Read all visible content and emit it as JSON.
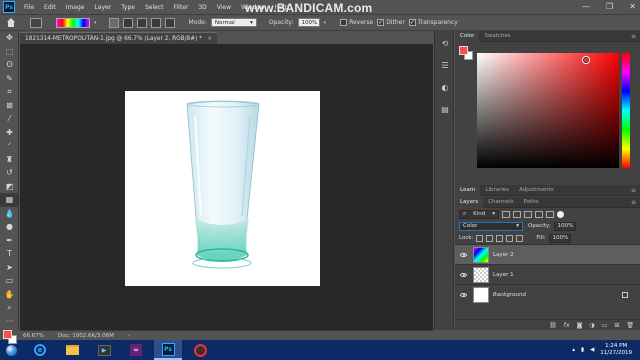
{
  "app": {
    "logo": "Ps",
    "menu": [
      "File",
      "Edit",
      "Image",
      "Layer",
      "Type",
      "Select",
      "Filter",
      "3D",
      "View",
      "Window",
      "Help"
    ],
    "watermark": "www.BANDICAM.com",
    "window_controls": [
      "—",
      "❐",
      "✕"
    ]
  },
  "options": {
    "mode_label": "Mode:",
    "mode_value": "Normal",
    "opacity_label": "Opacity:",
    "opacity_value": "100%",
    "reverse_label": "Reverse",
    "reverse_checked": false,
    "dither_label": "Dither",
    "dither_checked": true,
    "transparency_label": "Transparency",
    "transparency_checked": true
  },
  "document": {
    "tab_title": "1821314-METROPOLITAN-1.jpg @ 66.7% (Layer 2, RGB/8#) *",
    "close": "×",
    "zoom": "66.67%",
    "doc_size": "Doc: 1002.6K/3.06M"
  },
  "colors": {
    "foreground": "#ff4d4d",
    "background": "#ffffff"
  },
  "panels": {
    "color_tabs": [
      "Color",
      "Swatches"
    ],
    "mid_tabs": [
      "Learn",
      "Libraries",
      "Adjustments"
    ],
    "layer_tabs": [
      "Layers",
      "Channels",
      "Paths"
    ],
    "menu_glyph": "≡"
  },
  "layers_panel": {
    "kind_label": "Kind",
    "blend_mode": "Color",
    "opacity_label": "Opacity:",
    "opacity_value": "100%",
    "lock_label": "Lock:",
    "fill_label": "Fill:",
    "fill_value": "100%",
    "layers": [
      {
        "name": "Layer 2",
        "selected": true,
        "thumb": "gradient",
        "italic": false
      },
      {
        "name": "Layer 1",
        "selected": false,
        "thumb": "checker",
        "italic": false
      },
      {
        "name": "Background",
        "selected": false,
        "thumb": "white",
        "italic": true,
        "locked": true
      }
    ],
    "footer_icons": [
      "link-icon",
      "fx-icon",
      "mask-icon",
      "adjustment-icon",
      "folder-icon",
      "new-layer-icon",
      "trash-icon"
    ]
  },
  "taskbar": {
    "time": "1:24 PM",
    "date": "11/27/2019"
  }
}
